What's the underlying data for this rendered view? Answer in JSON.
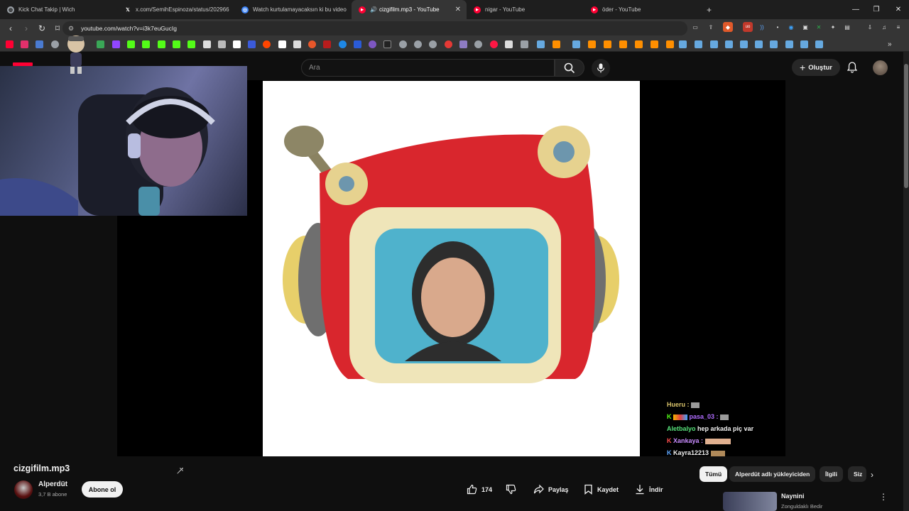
{
  "browser": {
    "tabs": [
      {
        "title": "Kick Chat Takip | Wich",
        "icon": "globe-icon"
      },
      {
        "title": "x.com/SemihEspinoza/status/202966",
        "icon": "x-icon"
      },
      {
        "title": "Watch kurtulamayacaksın ki bu video",
        "icon": "globe-icon"
      },
      {
        "title": "cizgifilm.mp3 - YouTube",
        "icon": "youtube-icon",
        "active": true
      },
      {
        "title": "nigar - YouTube",
        "icon": "youtube-icon"
      },
      {
        "title": "öder - YouTube",
        "icon": "youtube-icon"
      }
    ],
    "new_tab": "+",
    "url": "youtube.com/watch?v=i3k7euGucIg"
  },
  "youtube": {
    "search_placeholder": "Ara",
    "create_label": "Oluştur",
    "video_title": "cizgifilm.mp3",
    "channel_name": "Alperdüt",
    "subscribers": "3,7 B abone",
    "subscribe_label": "Abone ol",
    "like_count": "174",
    "share_label": "Paylaş",
    "save_label": "Kaydet",
    "download_label": "İndir",
    "chips": [
      "Tümü",
      "Alperdüt adlı yükleyiciden",
      "İlgili",
      "Siz"
    ],
    "recommendation": {
      "title": "Naynini",
      "channel": "Zonguldaklı Bedir"
    }
  },
  "chat_overlay": [
    {
      "user": "Hueru :",
      "text": "",
      "color": "#d9c36a"
    },
    {
      "user": "pasa_03 :",
      "text": "",
      "color": "#b06cff"
    },
    {
      "user": "Aletbalyo",
      "text": "hep arkada piç var",
      "color": "#57e07a"
    },
    {
      "user": "Xankaya :",
      "text": "",
      "color": "#c98cff"
    },
    {
      "user": "Kayra12213",
      "text": "",
      "color": "#f1f1f1"
    }
  ],
  "colors": {
    "youtube_red": "#ff0033",
    "page_bg": "#0f0f0f",
    "chrome_bg": "#353535"
  }
}
